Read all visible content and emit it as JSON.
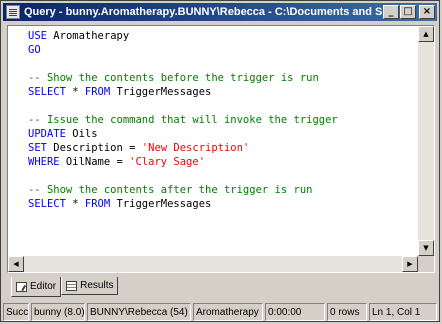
{
  "window": {
    "title": "Query - bunny.Aromatherapy.BUNNY\\Rebecca - C:\\Documents and S...",
    "controls": {
      "minimize": "_",
      "maximize": "□",
      "close": "×"
    }
  },
  "editor": {
    "lines": [
      [
        {
          "t": "USE ",
          "c": "kw"
        },
        {
          "t": "Aromatherapy",
          "c": "tx"
        }
      ],
      [
        {
          "t": "GO",
          "c": "kw"
        }
      ],
      [],
      [
        {
          "t": "-- Show the contents before the trigger is run",
          "c": "cm"
        }
      ],
      [
        {
          "t": "SELECT",
          "c": "kw"
        },
        {
          "t": " * ",
          "c": "tx"
        },
        {
          "t": "FROM",
          "c": "kw"
        },
        {
          "t": " TriggerMessages",
          "c": "tx"
        }
      ],
      [],
      [
        {
          "t": "-- Issue the command that will invoke the trigger",
          "c": "cm"
        }
      ],
      [
        {
          "t": "UPDATE",
          "c": "kw"
        },
        {
          "t": " Oils",
          "c": "tx"
        }
      ],
      [
        {
          "t": "SET",
          "c": "kw"
        },
        {
          "t": " Description = ",
          "c": "tx"
        },
        {
          "t": "'New Description'",
          "c": "st"
        }
      ],
      [
        {
          "t": "WHERE",
          "c": "kw"
        },
        {
          "t": " OilName = ",
          "c": "tx"
        },
        {
          "t": "'Clary Sage'",
          "c": "st"
        }
      ],
      [],
      [
        {
          "t": "-- Show the contents after the trigger is run",
          "c": "cm"
        }
      ],
      [
        {
          "t": "SELECT",
          "c": "kw"
        },
        {
          "t": " * ",
          "c": "tx"
        },
        {
          "t": "FROM",
          "c": "kw"
        },
        {
          "t": " TriggerMessages",
          "c": "tx"
        }
      ]
    ]
  },
  "scrollbars": {
    "up": "▲",
    "down": "▼",
    "left": "◀",
    "right": "▶"
  },
  "tabs": [
    {
      "label": "Editor",
      "active": true
    },
    {
      "label": "Results",
      "active": false
    }
  ],
  "status": {
    "state": "Succ",
    "server": "bunny (8.0)",
    "user": "BUNNY\\Rebecca (54)",
    "database": "Aromatherapy",
    "elapsed": "0:00:00",
    "rows": "0 rows",
    "position": "Ln 1, Col 1"
  }
}
